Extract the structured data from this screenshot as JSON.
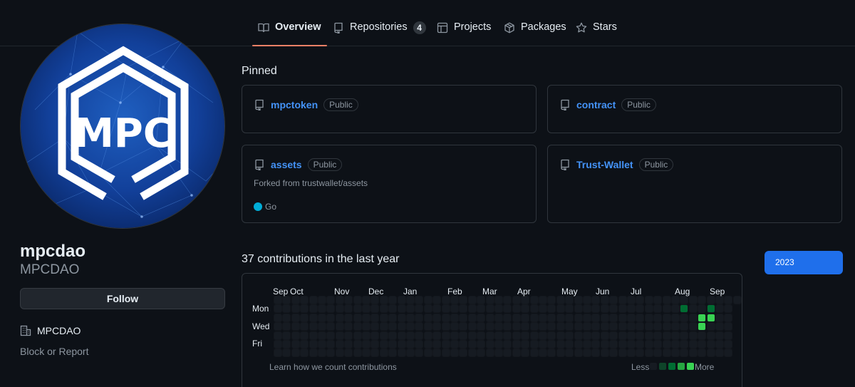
{
  "nav": {
    "tabs": [
      {
        "label": "Overview",
        "icon": "book-icon",
        "active": true
      },
      {
        "label": "Repositories",
        "icon": "repo-icon",
        "count": "4"
      },
      {
        "label": "Projects",
        "icon": "table-icon"
      },
      {
        "label": "Packages",
        "icon": "package-icon"
      },
      {
        "label": "Stars",
        "icon": "star-icon"
      }
    ]
  },
  "profile": {
    "avatar_text": "MPC",
    "name": "mpcdao",
    "login": "MPCDAO",
    "follow_label": "Follow",
    "org": "MPCDAO",
    "block_label": "Block or Report"
  },
  "pinned": {
    "title": "Pinned",
    "repos": [
      {
        "name": "mpctoken",
        "visibility": "Public"
      },
      {
        "name": "contract",
        "visibility": "Public"
      },
      {
        "name": "assets",
        "visibility": "Public",
        "description": "Forked from trustwallet/assets",
        "language": "Go",
        "language_color": "#00add8"
      },
      {
        "name": "Trust-Wallet",
        "visibility": "Public"
      }
    ]
  },
  "contributions": {
    "title": "37 contributions in the last year",
    "months": [
      "Sep",
      "Oct",
      "Nov",
      "Dec",
      "Jan",
      "Feb",
      "Mar",
      "Apr",
      "May",
      "Jun",
      "Jul",
      "Aug",
      "Sep"
    ],
    "days": [
      "Mon",
      "Wed",
      "Fri"
    ],
    "learn_link": "Learn how we count contributions",
    "less_label": "Less",
    "more_label": "More",
    "year_button": "2023",
    "colors": [
      "#161b22",
      "#0e4429",
      "#006d32",
      "#26a641",
      "#39d353"
    ],
    "active_cells": [
      {
        "week": 46,
        "day": 1,
        "level": 2
      },
      {
        "week": 48,
        "day": 2,
        "level": 4
      },
      {
        "week": 48,
        "day": 3,
        "level": 4
      },
      {
        "week": 49,
        "day": 1,
        "level": 2
      },
      {
        "week": 49,
        "day": 2,
        "level": 4
      }
    ]
  }
}
